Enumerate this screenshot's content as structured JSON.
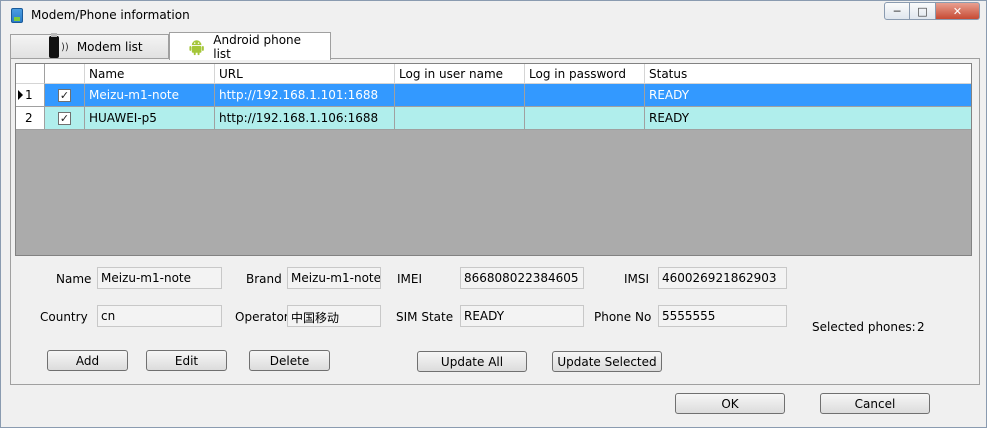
{
  "window": {
    "title": "Modem/Phone information"
  },
  "tabs": [
    {
      "label": "Modem list"
    },
    {
      "label": "Android phone list"
    }
  ],
  "table": {
    "columns": [
      "Name",
      "URL",
      "Log in user name",
      "Log in password",
      "Status"
    ],
    "rows": [
      {
        "index": "1",
        "checked": true,
        "name": "Meizu-m1-note",
        "url": "http://192.168.1.101:1688",
        "user": "",
        "password": "",
        "status": "READY"
      },
      {
        "index": "2",
        "checked": true,
        "name": "HUAWEI-p5",
        "url": "http://192.168.1.106:1688",
        "user": "",
        "password": "",
        "status": "READY"
      }
    ]
  },
  "details": {
    "name_label": "Name",
    "name_value": "Meizu-m1-note",
    "brand_label": "Brand",
    "brand_value": "Meizu-m1-note",
    "imei_label": "IMEI",
    "imei_value": "866808022384605",
    "imsi_label": "IMSI",
    "imsi_value": "460026921862903",
    "country_label": "Country",
    "country_value": "cn",
    "operator_label": "Operator",
    "operator_value": "中国移动",
    "sim_label": "SIM State",
    "sim_value": "READY",
    "phone_label": "Phone No",
    "phone_value": "5555555",
    "selected_label": "Selected phones:",
    "selected_count": "2"
  },
  "buttons": {
    "add": "Add",
    "edit": "Edit",
    "delete": "Delete",
    "update_all": "Update All",
    "update_selected": "Update Selected",
    "ok": "OK",
    "cancel": "Cancel"
  },
  "colors": {
    "selected_row": "#3399ff",
    "normal_row": "#b0eeec",
    "android_green": "#a4c639"
  }
}
